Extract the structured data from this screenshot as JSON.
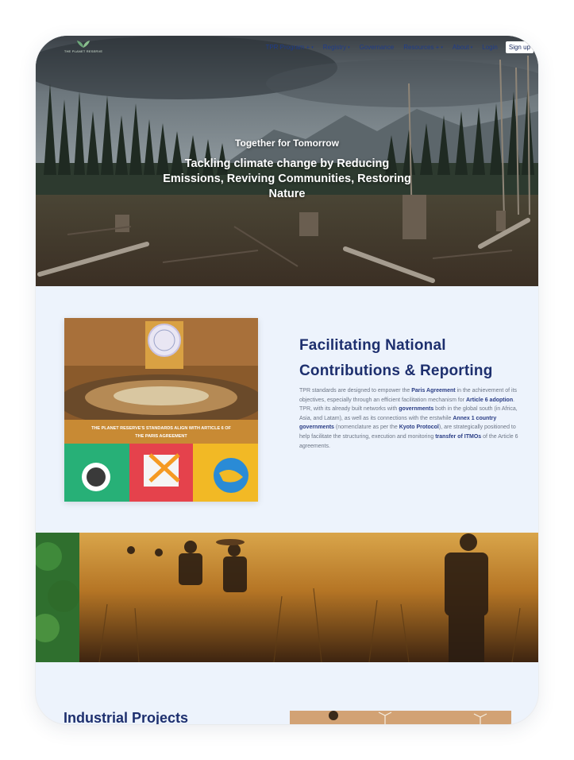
{
  "nav": {
    "logo_text": "THE PLANET RESERVE",
    "items": [
      {
        "label": "TPR Program +",
        "caret": true
      },
      {
        "label": "Registry",
        "caret": true
      },
      {
        "label": "Governance",
        "caret": false
      },
      {
        "label": "Resources +",
        "caret": true
      },
      {
        "label": "About",
        "caret": true
      },
      {
        "label": "Login",
        "caret": false
      }
    ],
    "signup_label": "Sign up"
  },
  "hero": {
    "tagline": "Together for Tomorrow",
    "title": "Tackling climate change by Reducing Emissions, Reviving Communities, Restoring Nature"
  },
  "feature": {
    "title": "Facilitating National Contributions & Reporting",
    "image_caption": "THE PLANET RESERVE'S STANDARDS ALIGN WITH ARTICLE 6 OF THE PARIS AGREEMENT",
    "body": [
      {
        "t": "TPR standards are designed to empower the "
      },
      {
        "t": "Paris Agreement",
        "b": true
      },
      {
        "t": " in the achievement of its objectives, especially through an efficient facilitation mechanism for "
      },
      {
        "t": "Article 6 adoption",
        "b": true
      },
      {
        "t": ". TPR, with its already built networks with "
      },
      {
        "t": "governments",
        "b": true
      },
      {
        "t": " both in the global south (in Africa, Asia, and Latam), as well as its connections with the erstwhile "
      },
      {
        "t": "Annex 1 country governments",
        "b": true
      },
      {
        "t": " (nomenclature as per the "
      },
      {
        "t": "Kyoto Protocol",
        "b": true
      },
      {
        "t": "), are strategically positioned to help facilitate the structuring, execution and monitoring "
      },
      {
        "t": "transfer of ITMOs",
        "b": true
      },
      {
        "t": " of the Article 6 agreements."
      }
    ]
  },
  "industrial": {
    "title": "Industrial Projects"
  },
  "colors": {
    "navy": "#1d2f6e",
    "page_bg": "#edf3fc",
    "body_text": "#6c7585"
  }
}
